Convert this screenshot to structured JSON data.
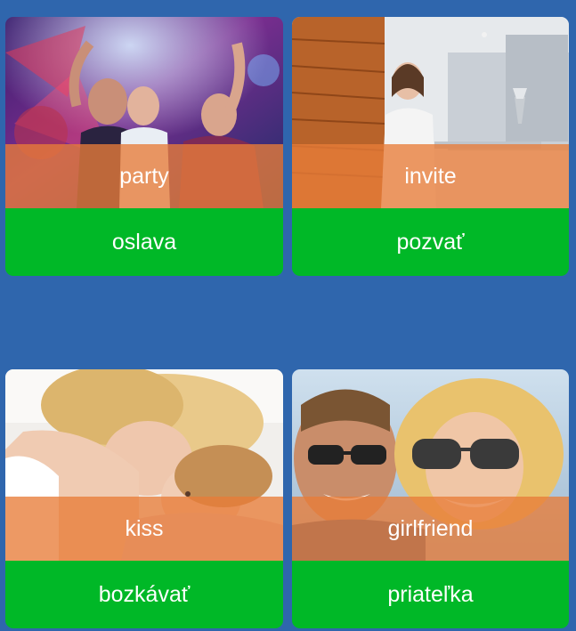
{
  "cards": [
    {
      "english": "party",
      "translation": "oslava"
    },
    {
      "english": "invite",
      "translation": "pozvať"
    },
    {
      "english": "kiss",
      "translation": "bozkávať"
    },
    {
      "english": "girlfriend",
      "translation": "priateľka"
    }
  ],
  "colors": {
    "background": "#2f66ad",
    "english_band": "#e87c38",
    "translation_band": "#00b827"
  }
}
